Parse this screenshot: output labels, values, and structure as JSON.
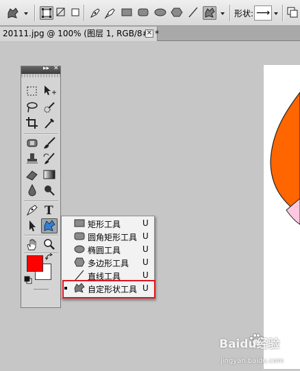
{
  "options_bar": {
    "shape_label": "形状:",
    "shape_preview": "⟶"
  },
  "document": {
    "tab_title": "20111.jpg @ 100% (图层 1, RGB/8#) *",
    "close_glyph": "✕"
  },
  "tools_panel": {
    "header_glyphs": "▸▸",
    "close_glyph": "✕",
    "foreground_color": "#ff0000",
    "background_color": "#ffffff"
  },
  "shape_flyout": {
    "items": [
      {
        "label": "矩形工具",
        "shortcut": "U",
        "icon": "rectangle-icon",
        "selected": false
      },
      {
        "label": "圆角矩形工具",
        "shortcut": "U",
        "icon": "rounded-rectangle-icon",
        "selected": false
      },
      {
        "label": "椭圆工具",
        "shortcut": "U",
        "icon": "ellipse-icon",
        "selected": false
      },
      {
        "label": "多边形工具",
        "shortcut": "U",
        "icon": "polygon-icon",
        "selected": false
      },
      {
        "label": "直线工具",
        "shortcut": "U",
        "icon": "line-icon",
        "selected": false
      },
      {
        "label": "自定形状工具",
        "shortcut": "U",
        "icon": "custom-shape-icon",
        "selected": true
      }
    ],
    "highlight_color": "#e0141b"
  },
  "canvas": {
    "shape_colors": [
      "#ff6600",
      "#ffc8e0"
    ]
  },
  "watermark": {
    "brand": "Baidu经验",
    "url": "jingyan.baidu.com"
  }
}
